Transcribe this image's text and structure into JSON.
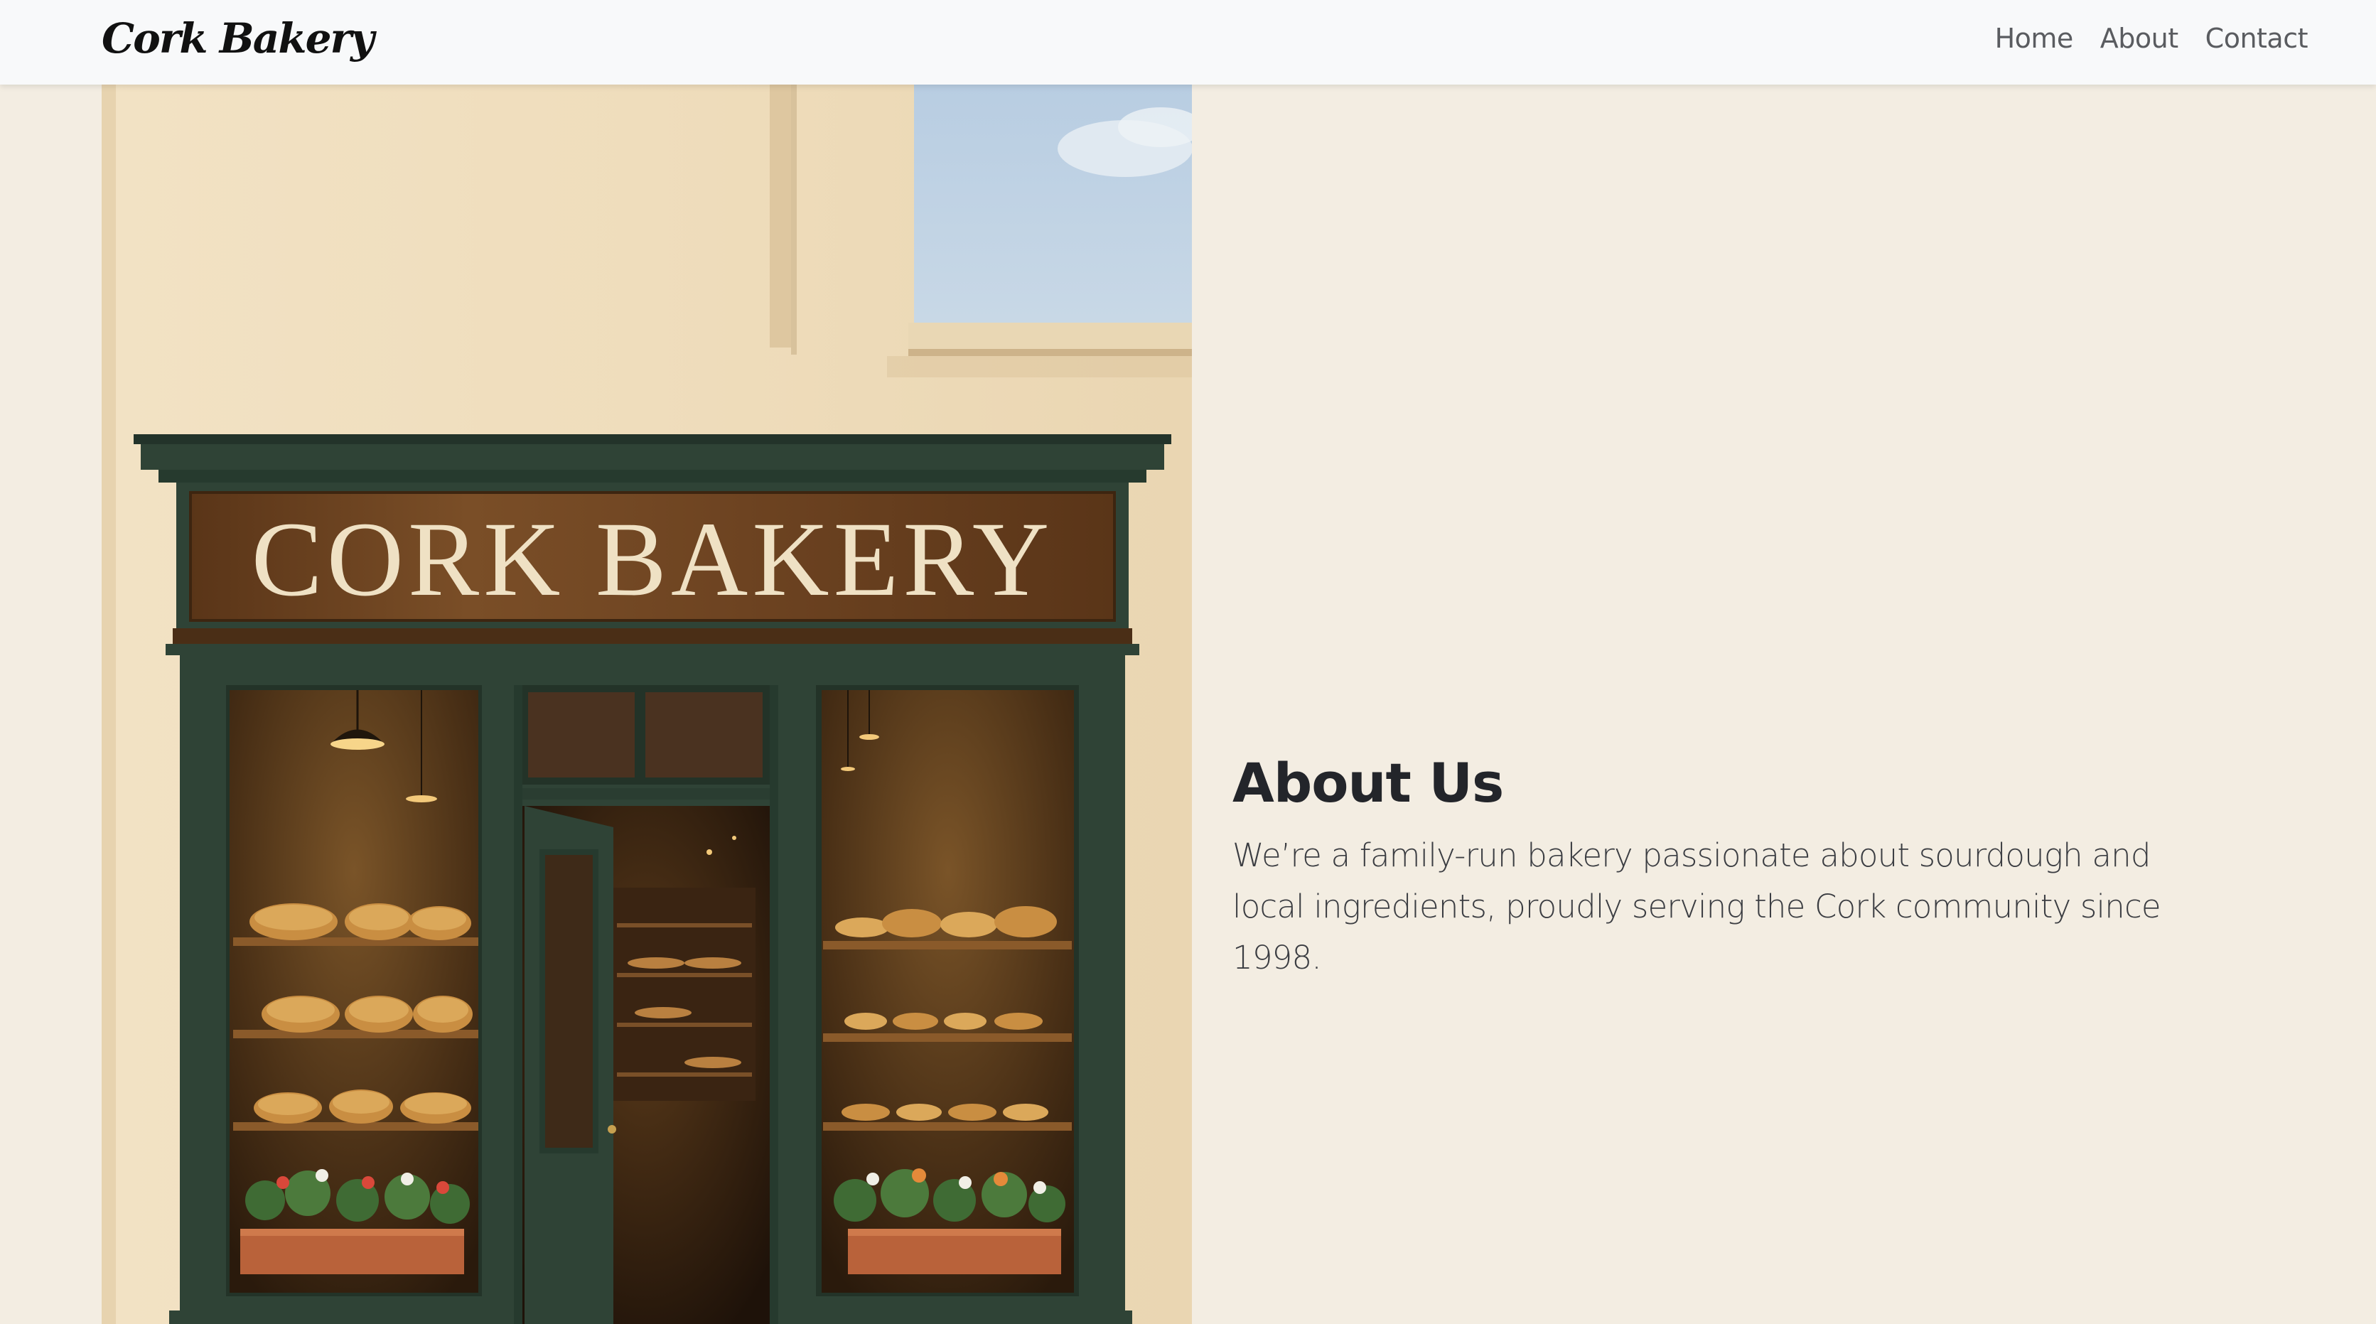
{
  "navbar": {
    "brand": "Cork Bakery",
    "links": [
      {
        "label": "Home"
      },
      {
        "label": "About"
      },
      {
        "label": "Contact"
      }
    ]
  },
  "hero": {
    "sign_text": "CORK BAKERY"
  },
  "about": {
    "heading": "About Us",
    "text": "We’re a family-run bakery passionate about sourdough and local ingredients, proudly serving the Cork community since 1998."
  },
  "colors": {
    "page_background": "#f3ede2",
    "navbar_background": "#f8f9fa",
    "storefront_green": "#2f4336",
    "sign_wood": "#6b4424",
    "wall_cream": "#efdfc0"
  }
}
